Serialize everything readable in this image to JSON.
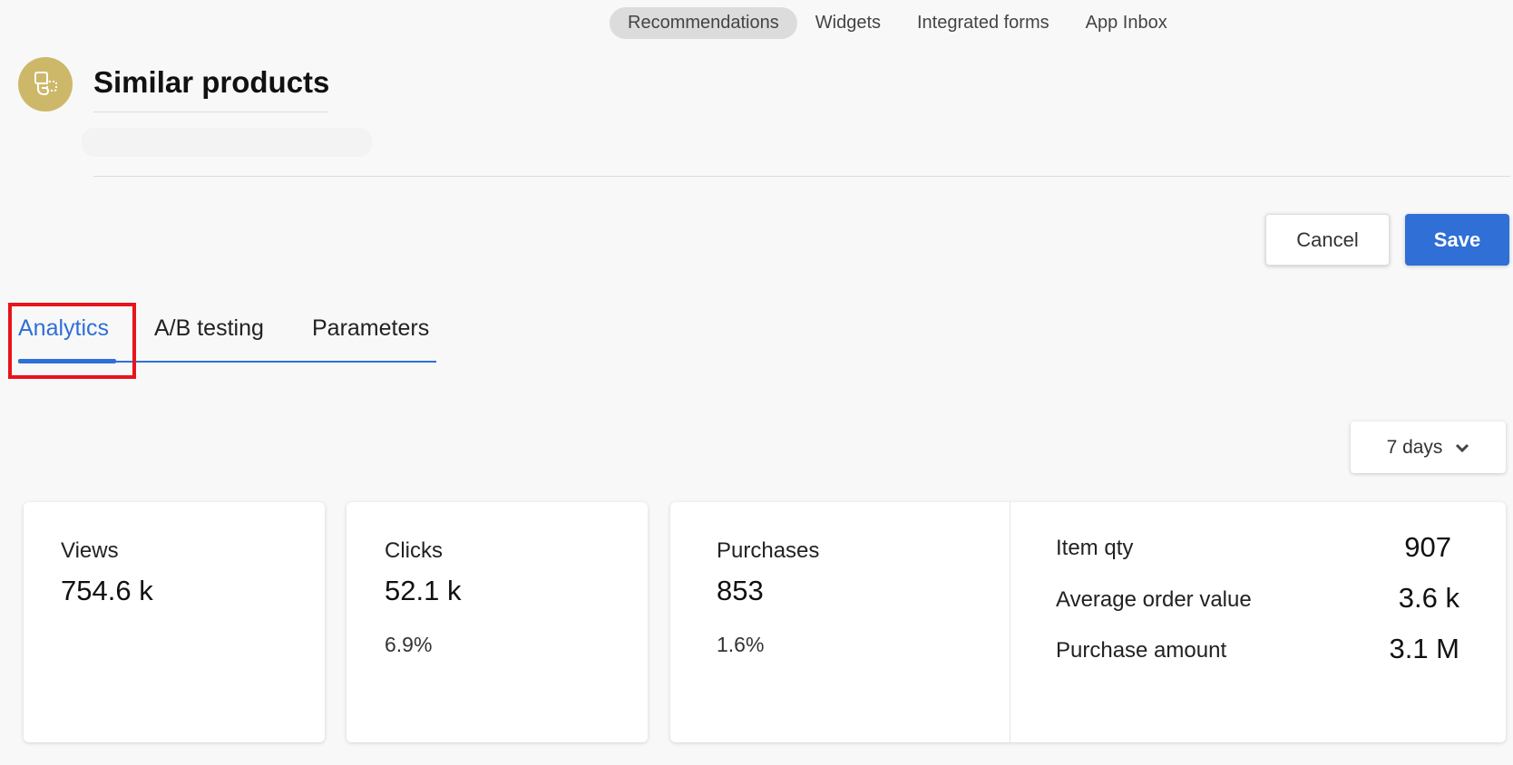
{
  "top_nav": {
    "items": [
      "Recommendations",
      "Widgets",
      "Integrated forms",
      "App Inbox"
    ],
    "active": "Recommendations"
  },
  "header": {
    "title": "Similar products",
    "icon": "similar-products-icon"
  },
  "actions": {
    "cancel": "Cancel",
    "save": "Save"
  },
  "tabs": {
    "items": [
      "Analytics",
      "A/B testing",
      "Parameters"
    ],
    "active": "Analytics"
  },
  "period": {
    "selected": "7 days"
  },
  "metrics": {
    "views": {
      "label": "Views",
      "value": "754.6 k"
    },
    "clicks": {
      "label": "Clicks",
      "value": "52.1 k",
      "rate": "6.9%"
    },
    "purchases": {
      "label": "Purchases",
      "value": "853",
      "rate": "1.6%"
    },
    "details": [
      {
        "label": "Item qty",
        "value": "907"
      },
      {
        "label": "Average order value",
        "value": "3.6 k"
      },
      {
        "label": "Purchase amount",
        "value": "3.1 M"
      }
    ]
  },
  "colors": {
    "accent": "#2f6fd6",
    "highlight": "#e8141b",
    "logo": "#cdb86a"
  }
}
